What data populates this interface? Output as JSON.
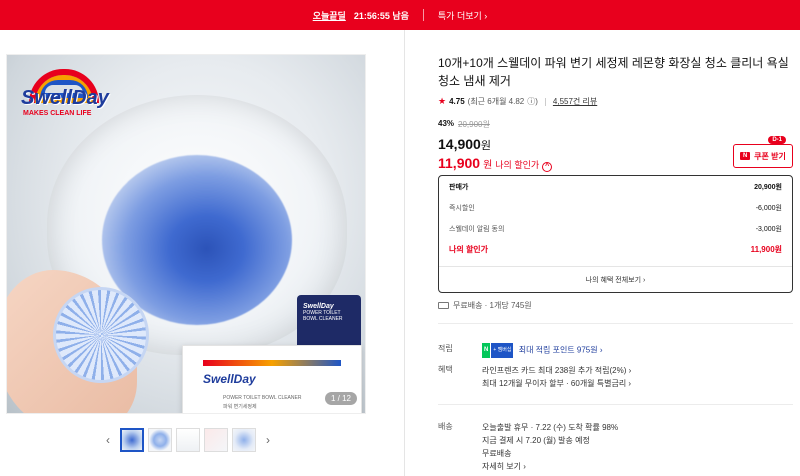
{
  "topbar": {
    "brand": "오늘끝딜",
    "timer": "21:56:55 남음",
    "deal_link": "특가 더보기 ›"
  },
  "gallery": {
    "logo_name": "SwellDay",
    "logo_tag": "MAKES CLEAN LIFE",
    "box_logo": "SwellDay",
    "box_text_1": "POWER TOILET BOWL CLEANER",
    "box_text_2": "파워 변기세정제",
    "pouch_logo": "SwellDay",
    "pouch_text": "POWER TOILET BOWL CLEANER",
    "counter": "1 / 12"
  },
  "product": {
    "title": "10개+10개 스웰데이 파워 변기 세정제 레몬향 화장실 청소 클리너 욕실 청소 냄새 제거",
    "rating_score": "4.75",
    "rating_recent": "(최근 6개월 4.82",
    "reviews": "4,557건 리뷰",
    "discount_pct": "43%",
    "original_price": "20,900원",
    "price": "14,900",
    "price_unit": "원",
    "my_price": "11,900",
    "my_price_unit": "원",
    "my_price_label": "나의 할인가",
    "coupon_label": "쿠폰 받기",
    "coupon_badge": "D-1"
  },
  "breakdown": {
    "rows": [
      {
        "label": "판매가",
        "value": "20,900원"
      },
      {
        "label": "즉시할인",
        "value": "-6,000원"
      },
      {
        "label": "스웰데이 알림 동의",
        "value": "-3,000원"
      }
    ],
    "mine_label": "나의 할인가",
    "mine_value": "11,900원",
    "more": "나의 혜택 전체보기 ›"
  },
  "shipping": {
    "text": "무료배송 · 1개당 745원"
  },
  "points": {
    "label": "적립",
    "npay_n": "N",
    "npay_p": "+ 멤버십",
    "text": "최대 적립 포인트 975원 ›"
  },
  "benefits": {
    "label": "혜택",
    "line1": "라인프렌즈 카드 최대 238원 추가 적립(2%) ›",
    "line2": "최대 12개월 무이자 할부 · 60개월 특별금리 ›"
  },
  "delivery": {
    "label": "배송",
    "line1": "오늘출발 휴무 · 7.22 (수) 도착 확률 98%",
    "line2": "지금 결제 시 7.20 (월) 발송 예정",
    "line3": "무료배송",
    "line4": "자세히 보기 ›"
  },
  "colors": {
    "accent": "#e8001d",
    "brand_blue": "#1e3c9c",
    "npay_green": "#03c75a"
  }
}
